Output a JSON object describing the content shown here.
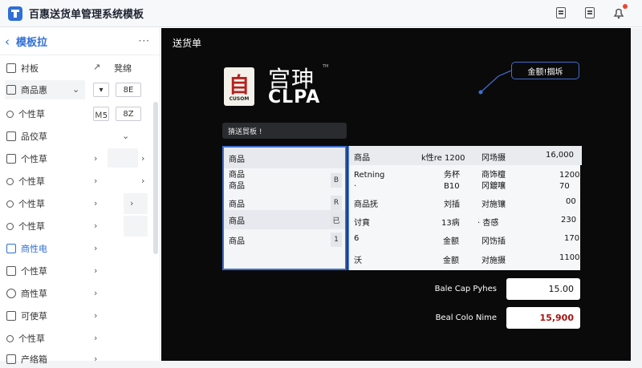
{
  "app": {
    "title": "百惠送货单管理系统模板"
  },
  "sidebar": {
    "title": "模板拉",
    "more": "···",
    "header_row": {
      "label": "衬板",
      "right_label": "凳绵"
    },
    "rows": [
      {
        "label": "商品惠",
        "box1": "▾",
        "box2": "8E"
      },
      {
        "label": "个性草",
        "box1": "Ｍ5",
        "box2": "8Z"
      },
      {
        "label": "品佼草"
      },
      {
        "label": "个性草"
      },
      {
        "label": "个性草"
      },
      {
        "label": "个性草"
      },
      {
        "label": "个性草"
      },
      {
        "label": "商性电"
      },
      {
        "label": "个性草"
      },
      {
        "label": "商性草"
      },
      {
        "label": "可使草"
      },
      {
        "label": "个性草"
      },
      {
        "label": "产络箱"
      }
    ]
  },
  "main": {
    "title": "送货单",
    "logo": {
      "char": "自",
      "sub": "CUSOM"
    },
    "brand": {
      "cn": "宫珅",
      "en": "CLPA",
      "tm": "TM"
    },
    "callout": "金额!掴坼",
    "form_field": "猜送貿板 !",
    "left_table": {
      "header": "商品",
      "rows": [
        {
          "label": "商品\n商品",
          "side": "B"
        },
        {
          "label": "商品",
          "side": "R"
        },
        {
          "label": "商品",
          "side": "已"
        },
        {
          "label": "商品",
          "side": "1"
        }
      ]
    },
    "right_table": {
      "header": [
        "商品",
        "k性re 1200",
        "冈场摄",
        "16,000"
      ],
      "rows": [
        [
          "Retning\n·",
          "务杯\nB10",
          "商饰檀\n冈鍍嚷",
          "1200\n70"
        ],
        [
          "商品抚",
          "刘插",
          "对施镶",
          "00"
        ],
        [
          "讨賁",
          "13病",
          "· 杏感",
          "230"
        ],
        [
          "6",
          "金额",
          "冈饬插",
          "170"
        ],
        [
          "沃",
          "金额",
          "对施摄",
          "1100"
        ]
      ]
    },
    "summary": [
      {
        "label": "Bale Cap Pyhes",
        "value": "15.00"
      },
      {
        "label": "Beal Colo Nime",
        "value": "15,900"
      }
    ]
  },
  "colors": {
    "accent": "#2f6fd6",
    "canvas": "#0a0a0b",
    "total_red": "#aa1111"
  }
}
